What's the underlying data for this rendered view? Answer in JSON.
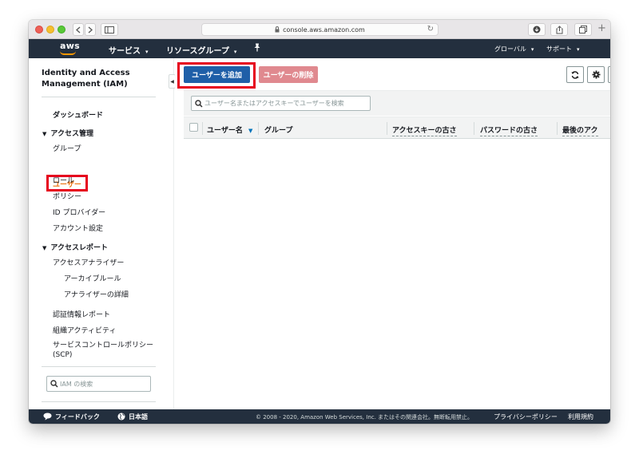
{
  "browser": {
    "url": "console.aws.amazon.com"
  },
  "aws_nav": {
    "logo_text": "aws",
    "services": "サービス",
    "resource_groups": "リソースグループ",
    "region": "グローバル",
    "support": "サポート"
  },
  "sidebar": {
    "title": "Identity and Access Management (IAM)",
    "dashboard": "ダッシュボード",
    "access_management": "アクセス管理",
    "groups": "グループ",
    "users": "ユーザー",
    "roles": "ロール",
    "policies": "ポリシー",
    "id_providers": "ID プロバイダー",
    "account_settings": "アカウント設定",
    "access_reports": "アクセスレポート",
    "access_analyzer": "アクセスアナライザー",
    "archive_rules": "アーカイブルール",
    "analyzer_details": "アナライザーの詳細",
    "credential_report": "認証情報レポート",
    "org_activity": "組織アクティビティ",
    "scp_line1": "サービスコントロールポリシー",
    "scp_line2": "(SCP)",
    "search_placeholder": "IAM の検索"
  },
  "toolbar": {
    "add_user": "ユーザーを追加",
    "delete_user": "ユーザーの削除",
    "search_placeholder": "ユーザー名またはアクセスキーでユーザーを検索"
  },
  "table": {
    "columns": [
      "ユーザー名",
      "グループ",
      "アクセスキーの古さ",
      "パスワードの古さ",
      "最後のアク"
    ]
  },
  "footer": {
    "feedback": "フィードバック",
    "language": "日本語",
    "copyright": "© 2008 - 2020, Amazon Web Services, Inc. またはその関連会社。無断転用禁止。",
    "privacy": "プライバシーポリシー",
    "terms": "利用規約"
  }
}
